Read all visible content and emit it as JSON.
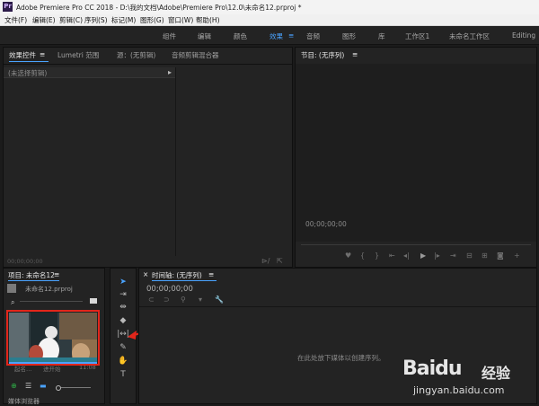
{
  "window": {
    "app_icon_text": "Pr",
    "title": "Adobe Premiere Pro CC 2018 - D:\\我的文档\\Adobe\\Premiere Pro\\12.0\\未命名12.prproj *"
  },
  "menubar": {
    "items": [
      "文件(F)",
      "编辑(E)",
      "剪辑(C)",
      "序列(S)",
      "标记(M)",
      "图形(G)",
      "窗口(W)",
      "帮助(H)"
    ]
  },
  "workspaces": {
    "items": [
      "组件",
      "编辑",
      "颜色",
      "效果",
      "音频",
      "图形",
      "库",
      "工作区1",
      "未命名工作区",
      "Editing"
    ],
    "active": "效果",
    "menu_icon": "≡"
  },
  "effect_controls": {
    "tab_label": "效果控件",
    "tab_menu_icon": "≡",
    "tab2_label": "Lumetri 范围",
    "tab3_label": "源：(无剪辑)",
    "tab4_label": "音频剪辑混合器",
    "no_clip_label": "(未选择剪辑)",
    "timecode": "00;00;00;00"
  },
  "program_monitor": {
    "tab_label": "节目: (无序列)",
    "tab_menu_icon": "≡",
    "timecode": "00;00;00;00"
  },
  "project_panel": {
    "tab_label": "项目: 未命名12",
    "tab_menu_icon": "≡",
    "file_name": "未命名12.prproj",
    "clip_name": "起名…",
    "clip_info": "进开始",
    "clip_duration": "11:08",
    "bottom_tab_label": "媒体浏览器"
  },
  "timeline": {
    "tab_label": "时间轴: (无序列)",
    "close_icon": "×",
    "tab_menu_icon": "≡",
    "timecode": "00;00;00;00",
    "drop_hint": "在此处放下媒体以创建序列。"
  },
  "watermark": {
    "brand": "Baidu",
    "brand_cn": "经验",
    "url": "jingyan.baidu.com"
  },
  "colors": {
    "accent": "#4aa3ff",
    "highlight_box": "#e2261b",
    "panel_bg": "#232323"
  }
}
